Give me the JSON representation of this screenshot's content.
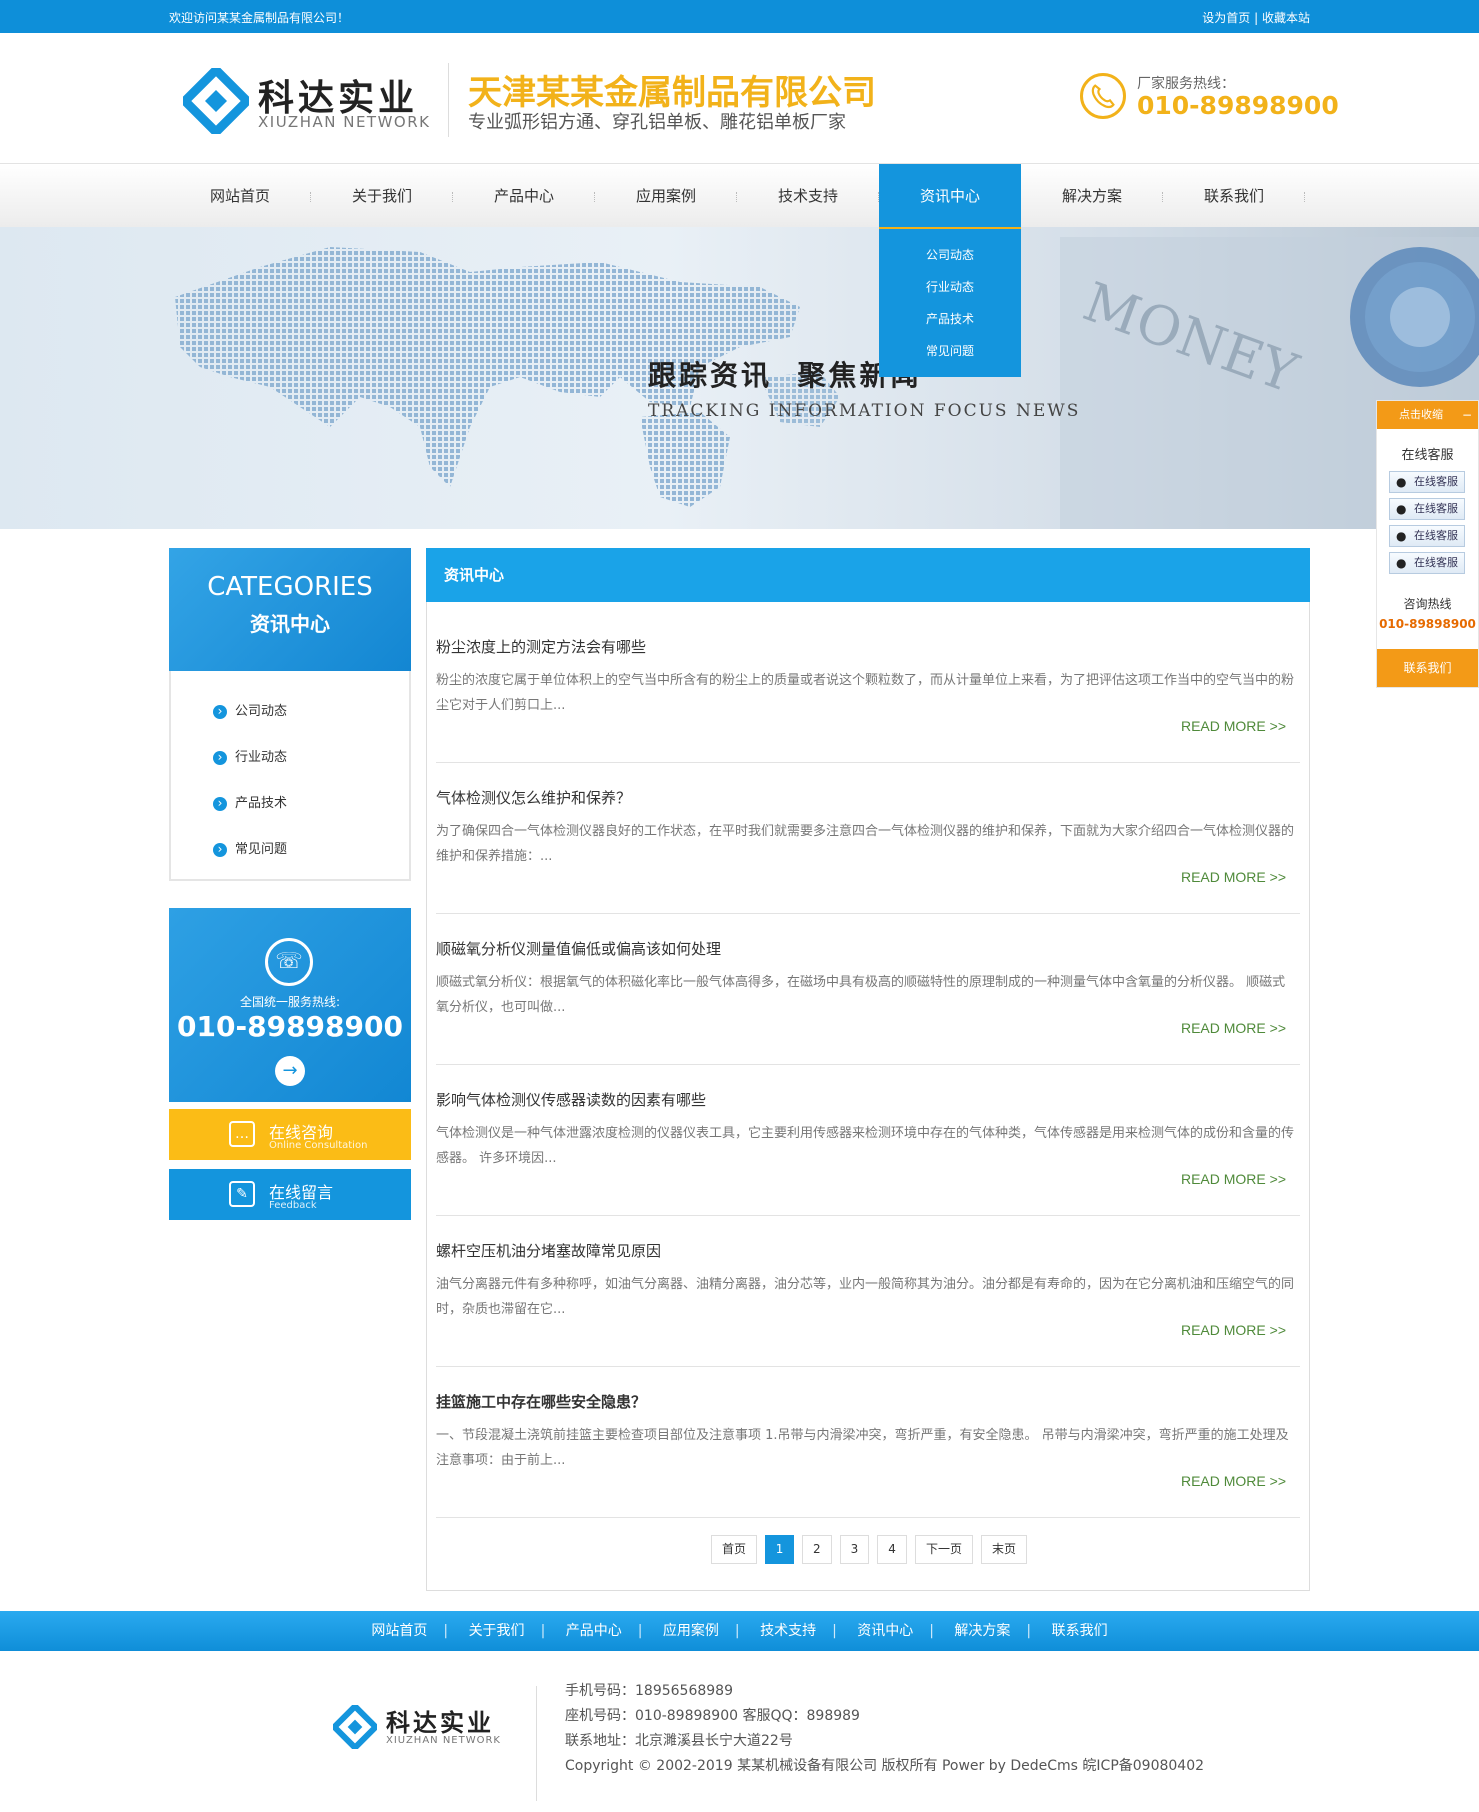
{
  "topbar": {
    "welcome": "欢迎访问某某金属制品有限公司！",
    "set_home": "设为首页",
    "separator": "|",
    "bookmark": "收藏本站"
  },
  "header": {
    "logo_title": "科达实业",
    "logo_sub": "XIUZHAN NETWORK",
    "company": "天津某某金属制品有限公司",
    "slogan": "专业弧形铝方通、穿孔铝单板、雕花铝单板厂家",
    "phone_label": "厂家服务热线：",
    "phone": "010-89898900"
  },
  "nav": {
    "items": [
      "网站首页",
      "关于我们",
      "产品中心",
      "应用案例",
      "技术支持",
      "资讯中心",
      "解决方案",
      "联系我们"
    ],
    "active": "资讯中心",
    "dropdown": [
      "公司动态",
      "行业动态",
      "产品技术",
      "常见问题"
    ]
  },
  "banner": {
    "title": "跟踪资讯  聚焦新闻",
    "subtitle": "TRACKING INFORMATION FOCUS NEWS"
  },
  "sidebar": {
    "cat_en": "CATEGORIES",
    "cat_cn": "资讯中心",
    "items": [
      "公司动态",
      "行业动态",
      "产品技术",
      "常见问题"
    ],
    "hotline_label": "全国统一服务热线:",
    "hotline": "010-89898900",
    "consult_title": "在线咨询",
    "consult_sub": "Online Consultation",
    "feedback_title": "在线留言",
    "feedback_sub": "Feedback"
  },
  "main": {
    "heading": "资讯中心",
    "read_more": "READ MORE >>",
    "articles": [
      {
        "title": "粉尘浓度上的测定方法会有哪些",
        "desc": "粉尘的浓度它属于单位体积上的空气当中所含有的粉尘上的质量或者说这个颗粒数了，而从计量单位上来看，为了把评估这项工作当中的空气当中的粉尘它对于人们剪口上..."
      },
      {
        "title": "气体检测仪怎么维护和保养？",
        "desc": "为了确保四合一气体检测仪器良好的工作状态，在平时我们就需要多注意四合一气体检测仪器的维护和保养，下面就为大家介绍四合一气体检测仪器的维护和保养措施：..."
      },
      {
        "title": "顺磁氧分析仪测量值偏低或偏高该如何处理",
        "desc": "顺磁式氧分析仪：根据氧气的体积磁化率比一般气体高得多，在磁场中具有极高的顺磁特性的原理制成的一种测量气体中含氧量的分析仪器。 顺磁式氧分析仪，也可叫做..."
      },
      {
        "title": "影响气体检测仪传感器读数的因素有哪些",
        "desc": "气体检测仪是一种气体泄露浓度检测的仪器仪表工具，它主要利用传感器来检测环境中存在的气体种类，气体传感器是用来检测气体的成份和含量的传感器。 许多环境因..."
      },
      {
        "title": "螺杆空压机油分堵塞故障常见原因",
        "desc": "油气分离器元件有多种称呼，如油气分离器、油精分离器，油分芯等，业内一般简称其为油分。油分都是有寿命的，因为在它分离机油和压缩空气的同时，杂质也滞留在它..."
      },
      {
        "title": "挂篮施工中存在哪些安全隐患？",
        "desc": "一、节段混凝土浇筑前挂篮主要检查项目部位及注意事项 1.吊带与内滑梁冲突，弯折严重，有安全隐患。 吊带与内滑梁冲突，弯折严重的施工处理及注意事项：由于前上..."
      }
    ],
    "pager": {
      "first": "首页",
      "pages": [
        "1",
        "2",
        "3",
        "4"
      ],
      "current": "1",
      "next": "下一页",
      "last": "末页"
    }
  },
  "footer_nav": [
    "网站首页",
    "关于我们",
    "产品中心",
    "应用案例",
    "技术支持",
    "资讯中心",
    "解决方案",
    "联系我们"
  ],
  "footer": {
    "logo_title": "科达实业",
    "logo_sub": "XIUZHAN NETWORK",
    "mobile": "手机号码：18956568989",
    "landline": "座机号码：010-89898900 客服QQ：898989",
    "address": "联系地址：北京濉溪县长宁大道22号",
    "copyright": "Copyright © 2002-2019 某某机械设备有限公司 版权所有 Power by DedeCms 皖ICP备09080402"
  },
  "float": {
    "toggle": "点击收缩",
    "close": "−",
    "title": "在线客服",
    "qq": [
      "在线客服",
      "在线客服",
      "在线客服",
      "在线客服"
    ],
    "hotline_label": "咨询热线",
    "hotline": "010-89898900",
    "contact": "联系我们"
  },
  "colors": {
    "primary": "#1495dd",
    "accent": "#f2b21a",
    "orange": "#f39a17",
    "read_more": "#4f8a3a"
  }
}
